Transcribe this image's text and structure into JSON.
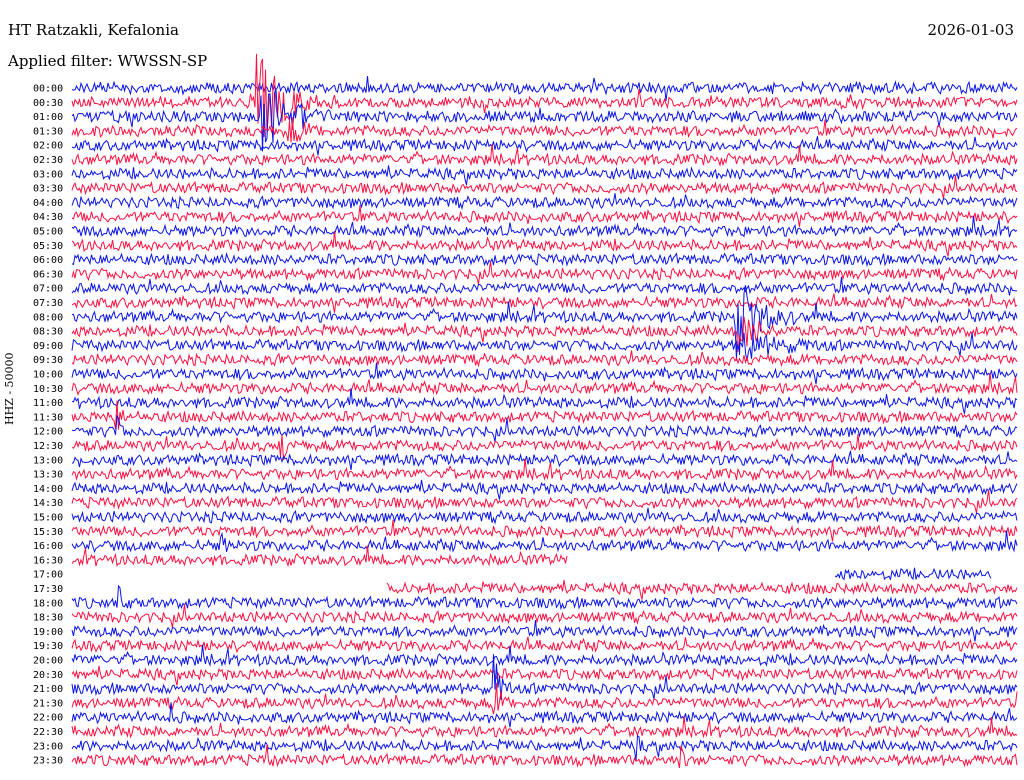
{
  "header": {
    "station": "HT Ratzakli, Kefalonia",
    "date": "2026-01-03",
    "filter": "Applied filter: WWSSN-SP"
  },
  "channel_label": "HHZ - 50000",
  "colors": {
    "odd_rows": "#0a14e6",
    "even_rows": "#ff1040",
    "background": "#ffffff"
  },
  "time_labels": [
    "00:00",
    "00:30",
    "01:00",
    "01:30",
    "02:00",
    "02:30",
    "03:00",
    "03:30",
    "04:00",
    "04:30",
    "05:00",
    "05:30",
    "06:00",
    "06:30",
    "07:00",
    "07:30",
    "08:00",
    "08:30",
    "09:00",
    "09:30",
    "10:00",
    "10:30",
    "11:00",
    "11:30",
    "12:00",
    "12:30",
    "13:00",
    "13:30",
    "14:00",
    "14:30",
    "15:00",
    "15:30",
    "16:00",
    "16:30",
    "17:00",
    "17:30",
    "18:00",
    "18:30",
    "19:00",
    "19:30",
    "20:00",
    "20:30",
    "21:00",
    "21:30",
    "22:00",
    "22:30",
    "23:00",
    "23:30"
  ]
}
